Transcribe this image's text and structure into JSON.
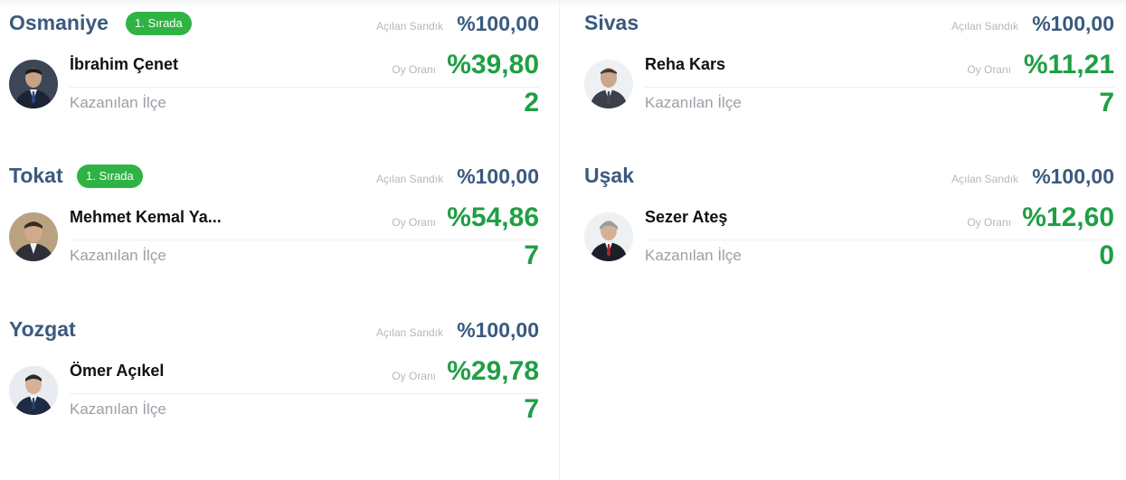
{
  "labels": {
    "opened_boxes": "Açılan Sandık",
    "vote_rate": "Oy Oranı",
    "won_districts": "Kazanılan İlçe"
  },
  "colors": {
    "city": "#3a5a80",
    "value_green": "#1f9f45",
    "badge_green": "#2fb344",
    "muted": "#b3b8be"
  },
  "cards": [
    {
      "city": "Osmaniye",
      "badge": "1. Sırada",
      "opened_boxes": "%100,00",
      "candidate": "İbrahim Çenet",
      "vote_rate": "%39,80",
      "won_districts": "2",
      "avatar_icon": "candidate-photo"
    },
    {
      "city": "Tokat",
      "badge": "1. Sırada",
      "opened_boxes": "%100,00",
      "candidate": "Mehmet Kemal Ya...",
      "vote_rate": "%54,86",
      "won_districts": "7",
      "avatar_icon": "candidate-photo"
    },
    {
      "city": "Yozgat",
      "badge": "",
      "opened_boxes": "%100,00",
      "candidate": "Ömer Açıkel",
      "vote_rate": "%29,78",
      "won_districts": "7",
      "avatar_icon": "candidate-photo"
    },
    {
      "city": "Sivas",
      "badge": "",
      "opened_boxes": "%100,00",
      "candidate": "Reha Kars",
      "vote_rate": "%11,21",
      "won_districts": "7",
      "avatar_icon": "candidate-photo"
    },
    {
      "city": "Uşak",
      "badge": "",
      "opened_boxes": "%100,00",
      "candidate": "Sezer Ateş",
      "vote_rate": "%12,60",
      "won_districts": "0",
      "avatar_icon": "candidate-photo"
    }
  ]
}
